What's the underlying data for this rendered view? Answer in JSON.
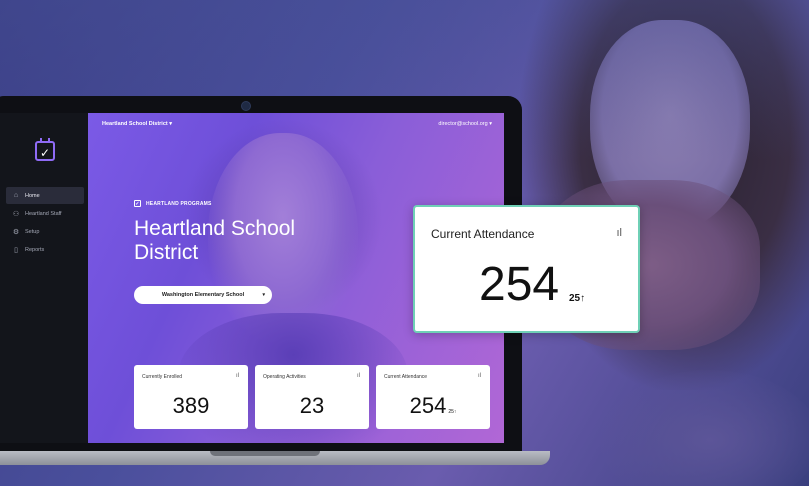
{
  "app": {
    "district_selector": "Heartland School District",
    "user_email": "director@school.org",
    "program_label": "HEARTLAND PROGRAMS",
    "page_title": "Heartland School District",
    "school_select": "Washington Elementary School"
  },
  "sidebar": {
    "items": [
      {
        "icon": "home-icon",
        "label": "Home"
      },
      {
        "icon": "staff-icon",
        "label": "Heartland Staff"
      },
      {
        "icon": "gear-icon",
        "label": "Setup"
      },
      {
        "icon": "document-icon",
        "label": "Reports"
      }
    ]
  },
  "cards": [
    {
      "label": "Currently Enrolled",
      "value": "389",
      "delta": ""
    },
    {
      "label": "Operating Activities",
      "value": "23",
      "delta": ""
    },
    {
      "label": "Current Attendance",
      "value": "254",
      "delta": "25↑"
    }
  ],
  "float_card": {
    "label": "Current Attendance",
    "value": "254",
    "delta": "25↑"
  },
  "colors": {
    "accent": "#8f6bf5",
    "float_border": "#6fd0b6",
    "sidebar_bg": "#13151b"
  }
}
